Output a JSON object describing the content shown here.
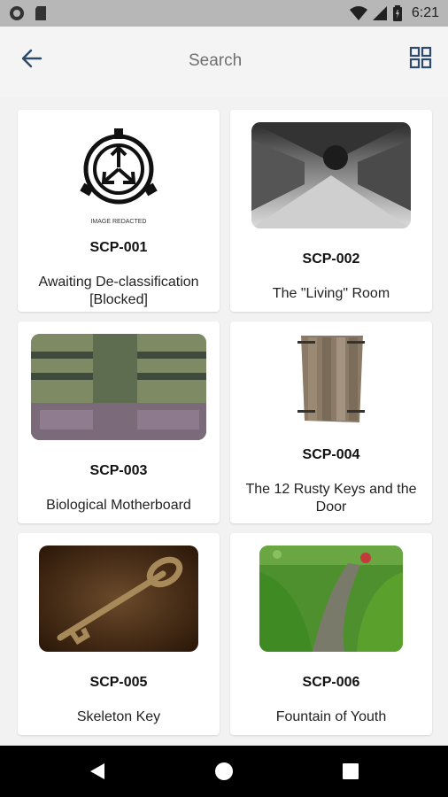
{
  "status_bar": {
    "time": "6:21"
  },
  "app_bar": {
    "title": "Search"
  },
  "cards": [
    {
      "id": "SCP-001",
      "title": "Awaiting De-classification [Blocked]",
      "image_caption": "IMAGE REDACTED"
    },
    {
      "id": "SCP-002",
      "title": "The \"Living\" Room"
    },
    {
      "id": "SCP-003",
      "title": "Biological Motherboard"
    },
    {
      "id": "SCP-004",
      "title": "The 12 Rusty Keys and the Door"
    },
    {
      "id": "SCP-005",
      "title": "Skeleton Key"
    },
    {
      "id": "SCP-006",
      "title": "Fountain of Youth"
    }
  ]
}
